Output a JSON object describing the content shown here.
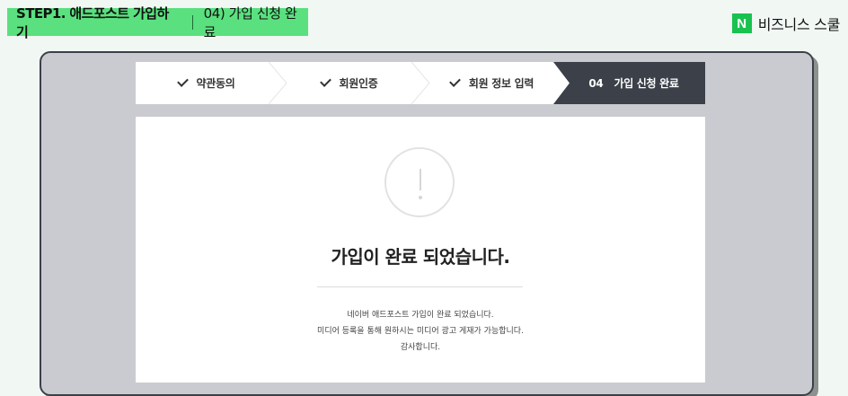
{
  "banner": {
    "title": "STEP1. 애드포스트 가입하기",
    "subtitle": "04) 가입 신청 완료",
    "color": "#5ae07f"
  },
  "brand": {
    "logo_letter": "N",
    "name": "비즈니스 스쿨",
    "logo_color": "#19c24f"
  },
  "steps": [
    {
      "label": "약관동의",
      "state": "done",
      "icon": "check-icon"
    },
    {
      "label": "회원인증",
      "state": "done",
      "icon": "check-icon"
    },
    {
      "label": "회원 정보 입력",
      "state": "done",
      "icon": "check-icon"
    },
    {
      "number": "04",
      "label": "가입 신청 완료",
      "state": "active"
    }
  ],
  "result": {
    "icon": "exclamation-circle-icon",
    "title": "가입이 완료 되었습니다.",
    "lines": [
      "네이버 애드포스트 가입이 완료 되었습니다.",
      "미디어 등록을 통해 원하시는 미디어 광고 게재가 가능합니다.",
      "감사합니다."
    ]
  },
  "colors": {
    "active_step": "#3b4049",
    "background": "#f1f8f3"
  }
}
